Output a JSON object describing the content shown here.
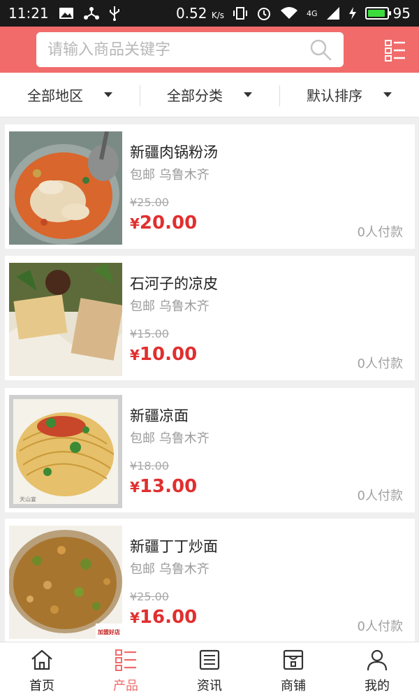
{
  "status_bar": {
    "time": "11:21",
    "speed": "0.52",
    "speed_unit": "K/s",
    "network": "4G",
    "battery": "95",
    "battery_level": 0.95
  },
  "search": {
    "placeholder": "请输入商品关键字"
  },
  "filters": [
    {
      "label": "全部地区"
    },
    {
      "label": "全部分类"
    },
    {
      "label": "默认排序"
    }
  ],
  "products": [
    {
      "name": "新疆肉锅粉汤",
      "shipping": "包邮 乌鲁木齐",
      "old_price": "¥25.00",
      "currency": "¥",
      "price": "20.00",
      "paid": "0人付款"
    },
    {
      "name": "石河子的凉皮",
      "shipping": "包邮 乌鲁木齐",
      "old_price": "¥15.00",
      "currency": "¥",
      "price": "10.00",
      "paid": "0人付款"
    },
    {
      "name": "新疆凉面",
      "shipping": "包邮 乌鲁木齐",
      "old_price": "¥18.00",
      "currency": "¥",
      "price": "13.00",
      "paid": "0人付款"
    },
    {
      "name": "新疆丁丁炒面",
      "shipping": "包邮 乌鲁木齐",
      "old_price": "¥25.00",
      "currency": "¥",
      "price": "16.00",
      "paid": "0人付款"
    }
  ],
  "nav": [
    {
      "label": "首页",
      "icon": "home-icon"
    },
    {
      "label": "产品",
      "icon": "product-list-icon",
      "active": true
    },
    {
      "label": "资讯",
      "icon": "news-icon"
    },
    {
      "label": "商铺",
      "icon": "store-icon"
    },
    {
      "label": "我的",
      "icon": "user-icon"
    }
  ],
  "colors": {
    "accent": "#f16b6b",
    "price": "#e12f2f"
  }
}
